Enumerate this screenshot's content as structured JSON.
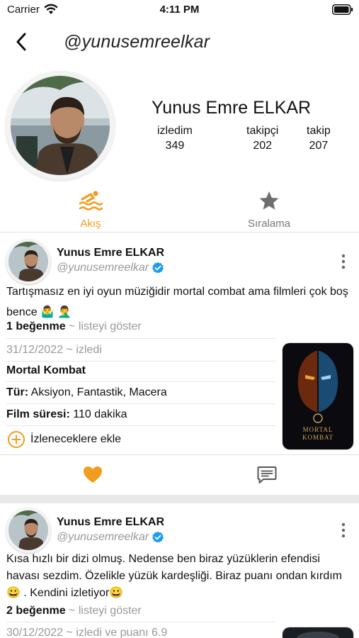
{
  "status_bar": {
    "carrier": "Carrier",
    "time": "4:11 PM"
  },
  "nav": {
    "title": "@yunusemreelkar"
  },
  "profile": {
    "name": "Yunus Emre ELKAR",
    "stats": [
      {
        "label": "izledim",
        "value": "349"
      },
      {
        "label": "takipçi",
        "value": "202"
      },
      {
        "label": "takip",
        "value": "207"
      }
    ]
  },
  "tabs": [
    {
      "label": "Akış",
      "icon": "swim-icon",
      "active": true
    },
    {
      "label": "Sıralama",
      "icon": "star-icon",
      "active": false
    }
  ],
  "posts": [
    {
      "name": "Yunus Emre ELKAR",
      "handle": "@yunusemreelkar",
      "text": "Tartışmasız en iyi oyun müziğidir mortal combat ama filmleri çok boş bence 🤷‍♂️ 🤦‍♂️",
      "likes": "1 beğenme",
      "show_list": "~ listeyi göster",
      "watched": "31/12/2022 ~ izledi",
      "movie_title": "Mortal Kombat",
      "genre_label": "Tür:",
      "genre_value": "Aksiyon, Fantastik, Macera",
      "duration_label": "Film süresi:",
      "duration_value": "110 dakika",
      "watchlist": "İzleneceklere ekle",
      "poster_text": "MORTAL KOMBAT"
    },
    {
      "name": "Yunus Emre ELKAR",
      "handle": "@yunusemreelkar",
      "text": "Kısa hızlı bir dizi olmuş. Nedense ben biraz yüzüklerin efendisi havası sezdim. Özelikle yüzük kardeşliği. Biraz puanı ondan kırdım 😀 . Kendini izletiyor😀",
      "likes": "2 beğenme",
      "show_list": "~ listeyi göster",
      "watched": "30/12/2022 ~ izledi ve puanı 6.9"
    }
  ],
  "colors": {
    "accent": "#f39c1f",
    "verified": "#1d9bf0",
    "muted": "#999999"
  }
}
